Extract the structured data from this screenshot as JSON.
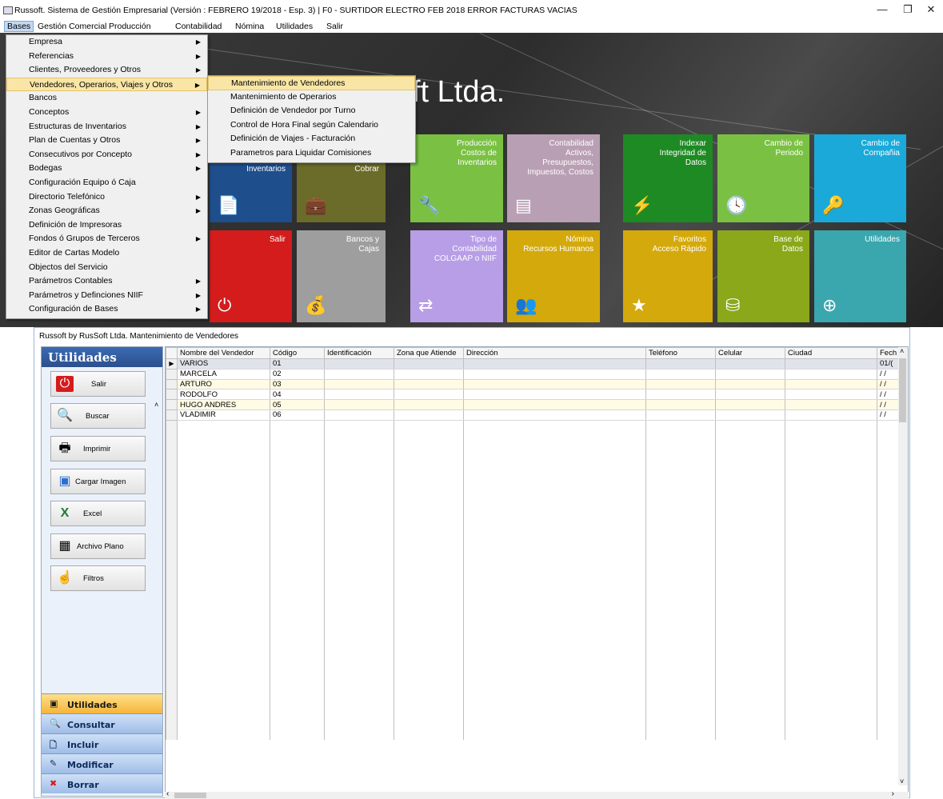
{
  "window": {
    "title": "Russoft. Sistema de Gestión Empresarial (Versión : FEBRERO 19/2018 - Esp. 3) | F0 - SURTIDOR ELECTRO FEB 2018 ERROR FACTURAS VACIAS",
    "minimize": "—",
    "maximize": "❐",
    "close": "✕"
  },
  "menubar": [
    "Bases",
    "Gestión Comercial",
    "Producción",
    "Contabilidad",
    "Nómina",
    "Utilidades",
    "Salir"
  ],
  "brand": "ft Ltda.",
  "bases_menu": [
    {
      "label": "Empresa",
      "sub": true
    },
    {
      "label": "Referencias",
      "sub": true
    },
    {
      "label": "Clientes, Proveedores y Otros",
      "sub": true
    },
    {
      "label": "Vendedores, Operarios, Viajes y Otros",
      "sub": true
    },
    {
      "label": "Bancos",
      "sub": false
    },
    {
      "label": "Conceptos",
      "sub": true
    },
    {
      "label": "Estructuras de Inventarios",
      "sub": true
    },
    {
      "label": "Plan de Cuentas y Otros",
      "sub": true
    },
    {
      "label": "Consecutivos por Concepto",
      "sub": true
    },
    {
      "label": "Bodegas",
      "sub": true
    },
    {
      "label": "Configuración  Equipo ó Caja",
      "sub": false
    },
    {
      "label": "Directorio Telefónico",
      "sub": true
    },
    {
      "label": "Zonas Geográficas",
      "sub": true
    },
    {
      "label": "Definición de Impresoras",
      "sub": false
    },
    {
      "label": "Fondos ó Grupos de Terceros",
      "sub": true
    },
    {
      "label": "Editor de Cartas Modelo",
      "sub": false
    },
    {
      "label": "Objectos del Servicio",
      "sub": false
    },
    {
      "label": "Parámetros Contables",
      "sub": true
    },
    {
      "label": "Parámetros y Definciones NIIF",
      "sub": true
    },
    {
      "label": "Configuración de Bases",
      "sub": true
    }
  ],
  "sub_menu": [
    "Mantenimiento de Vendedores",
    "Mantenimiento de Operarios",
    "Definición de Vendedor por Turno",
    "Control de Hora Final según Calendario",
    "Definición de Viajes - Facturación",
    "Parametros para Liquidar Comisiones"
  ],
  "tiles": [
    {
      "label": "Inventarios",
      "color": "#1f4e8c",
      "icon": "document-icon"
    },
    {
      "label": "Cobrar",
      "color": "#6b6b2a",
      "icon": "briefcase-icon"
    },
    {
      "label": "Producción\nCostos de\nInventarios",
      "color": "#7ac143",
      "icon": "tools-icon"
    },
    {
      "label": "Contabilidad\nActivos,\nPresupuestos,\nImpuestos, Costos",
      "color": "#b99fb4",
      "icon": "ledger-icon"
    },
    {
      "label": "Indexar\nIntegridad de\nDatos",
      "color": "#1e8a23",
      "icon": "lightning-icon"
    },
    {
      "label": "Cambio de\nPeriodo",
      "color": "#7ac143",
      "icon": "clock-icon"
    },
    {
      "label": "Cambio de\nCompañia",
      "color": "#1aa9d9",
      "icon": "keys-icon"
    },
    {
      "label": "Salir",
      "color": "#d41c1c",
      "icon": "power-icon"
    },
    {
      "label": "Bancos y\nCajas",
      "color": "#9e9e9e",
      "icon": "money-bag-icon"
    },
    {
      "label": "Tipo de\nContabilidad\nCOLGAAP o NIIF",
      "color": "#b79ee6",
      "icon": "exchange-icon"
    },
    {
      "label": "Nómina\nRecursos Humanos",
      "color": "#d4a90c",
      "icon": "people-icon"
    },
    {
      "label": "Favoritos\nAcceso Rápido",
      "color": "#d4a90c",
      "icon": "star-icon"
    },
    {
      "label": "Base de\nDatos",
      "color": "#8aa81a",
      "icon": "database-icon"
    },
    {
      "label": "Utilidades",
      "color": "#3aa6ae",
      "icon": "lifebuoy-icon"
    }
  ],
  "child": {
    "title": "Russoft by RusSoft Ltda. Mantenimiento de Vendedores",
    "panel_title": "Utilidades",
    "buttons": [
      "Salir",
      "Buscar",
      "Imprimir",
      "Cargar Imagen",
      "Excel",
      "Archivo Plano",
      "Filtros"
    ],
    "nav": [
      "Utilidades",
      "Consultar",
      "Incluir",
      "Modificar",
      "Borrar"
    ]
  },
  "table": {
    "columns": [
      "Nombre del Vendedor",
      "Código",
      "Identificación",
      "Zona que Atiende",
      "Dirección",
      "Teléfono",
      "Celular",
      "Ciudad",
      "Fech"
    ],
    "rows": [
      [
        "VARIOS",
        "01",
        "",
        "",
        "",
        "",
        "",
        "",
        "01/("
      ],
      [
        "MARCELA",
        "02",
        "",
        "",
        "",
        "",
        "",
        "",
        "/ /"
      ],
      [
        "ARTURO",
        "03",
        "",
        "",
        "",
        "",
        "",
        "",
        "/ /"
      ],
      [
        "RODOLFO",
        "04",
        "",
        "",
        "",
        "",
        "",
        "",
        "/ /"
      ],
      [
        "HUGO ANDRES",
        "05",
        "",
        "",
        "",
        "",
        "",
        "",
        "/ /"
      ],
      [
        "VLADIMIR",
        "06",
        "",
        "",
        "",
        "",
        "",
        "",
        "/ /"
      ]
    ],
    "current_row_marker": "▶"
  }
}
